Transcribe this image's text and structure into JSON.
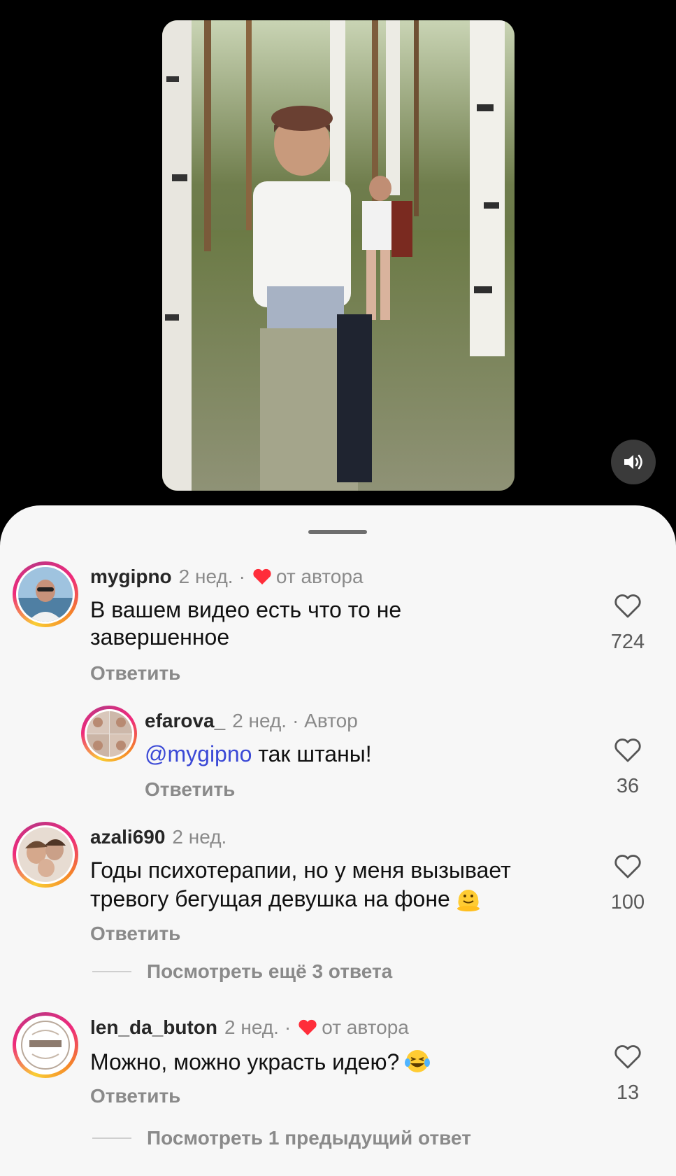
{
  "video": {
    "sound_icon": "speaker-on-icon"
  },
  "comments": [
    {
      "username": "mygipno",
      "time": "2 нед.",
      "separator": "·",
      "badge": "от автора",
      "text": "В вашем видео есть что то не завершенное",
      "reply_label": "Ответить",
      "likes": "724"
    },
    {
      "username": "efarova_",
      "time": "2 нед.",
      "badge": "· Автор",
      "mention": "@mygipno",
      "text": " так штаны!",
      "reply_label": "Ответить",
      "likes": "36"
    },
    {
      "username": "azali690",
      "time": "2 нед.",
      "text": "Годы психотерапии, но у меня вызывает тревогу бегущая девушка на фоне",
      "reply_label": "Ответить",
      "likes": "100",
      "more_replies": "Посмотреть ещё 3 ответа"
    },
    {
      "username": "len_da_buton",
      "time": "2 нед.",
      "separator": "·",
      "badge": "от автора",
      "text": "Можно, можно украсть идею?",
      "reply_label": "Ответить",
      "likes": "13",
      "more_replies": "Посмотреть 1 предыдущий ответ"
    }
  ],
  "colors": {
    "heart_badge": "#ff2d3a",
    "mention": "#3b49d6",
    "sheet_bg": "#f7f7f7"
  }
}
